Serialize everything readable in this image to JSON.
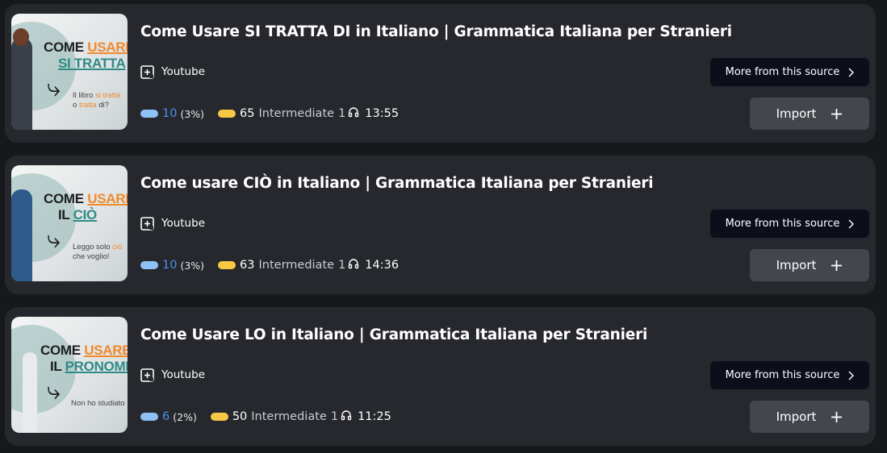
{
  "lessons": [
    {
      "title": "Come Usare SI TRATTA DI in Italiano | Grammatica Italiana per Stranieri",
      "thumbnail": {
        "line1_plain": "COME ",
        "line1_highlight": "USARE",
        "line2_highlight": "SI TRATTA",
        "caption_line1_pre": "Il libro ",
        "caption_line1_hl": "si tratta",
        "caption_line2_pre": "o ",
        "caption_line2_hl": "tratta",
        "caption_line2_post": " di?"
      },
      "source": "Youtube",
      "known_words": "10",
      "known_percent": "(3%)",
      "unknown_words": "65",
      "level": "Intermediate",
      "headphone_count": "1",
      "duration": "13:55",
      "more_label": "More from this source",
      "import_label": "Import"
    },
    {
      "title": "Come usare CIÒ in Italiano | Grammatica Italiana per Stranieri",
      "thumbnail": {
        "line1_plain": "COME ",
        "line1_highlight": "USARE",
        "line2_plain": "IL ",
        "line2_highlight": "CIÒ",
        "caption_line1_pre": "Leggo solo ",
        "caption_line1_hl": "ciò",
        "caption_line2_pre": "che voglio!"
      },
      "source": "Youtube",
      "known_words": "10",
      "known_percent": "(3%)",
      "unknown_words": "63",
      "level": "Intermediate",
      "headphone_count": "1",
      "duration": "14:36",
      "more_label": "More from this source",
      "import_label": "Import"
    },
    {
      "title": "Come Usare LO in Italiano | Grammatica Italiana per Stranieri",
      "thumbnail": {
        "line1_plain": "COME ",
        "line1_highlight": "USARE",
        "line2_plain": "IL ",
        "line2_highlight": "PRONOME",
        "caption_line1_pre": "Non ho studiato"
      },
      "source": "Youtube",
      "known_words": "6",
      "known_percent": "(2%)",
      "unknown_words": "50",
      "level": "Intermediate",
      "headphone_count": "1",
      "duration": "11:25",
      "more_label": "More from this source",
      "import_label": "Import"
    }
  ],
  "colors": {
    "background": "#17181b",
    "card": "#26282d",
    "known_pill": "#8ec1f5",
    "known_text": "#4d8fea",
    "unknown_pill": "#f6c945",
    "more_button": "#0c0f1a",
    "import_button": "#43464c",
    "thumb_orange": "#f08a2e",
    "thumb_teal": "#2f8a86"
  },
  "icons": {
    "source": "youtube-source-icon",
    "headphones": "headphones-icon",
    "chevron": "chevron-right-icon",
    "plus": "plus-icon"
  }
}
